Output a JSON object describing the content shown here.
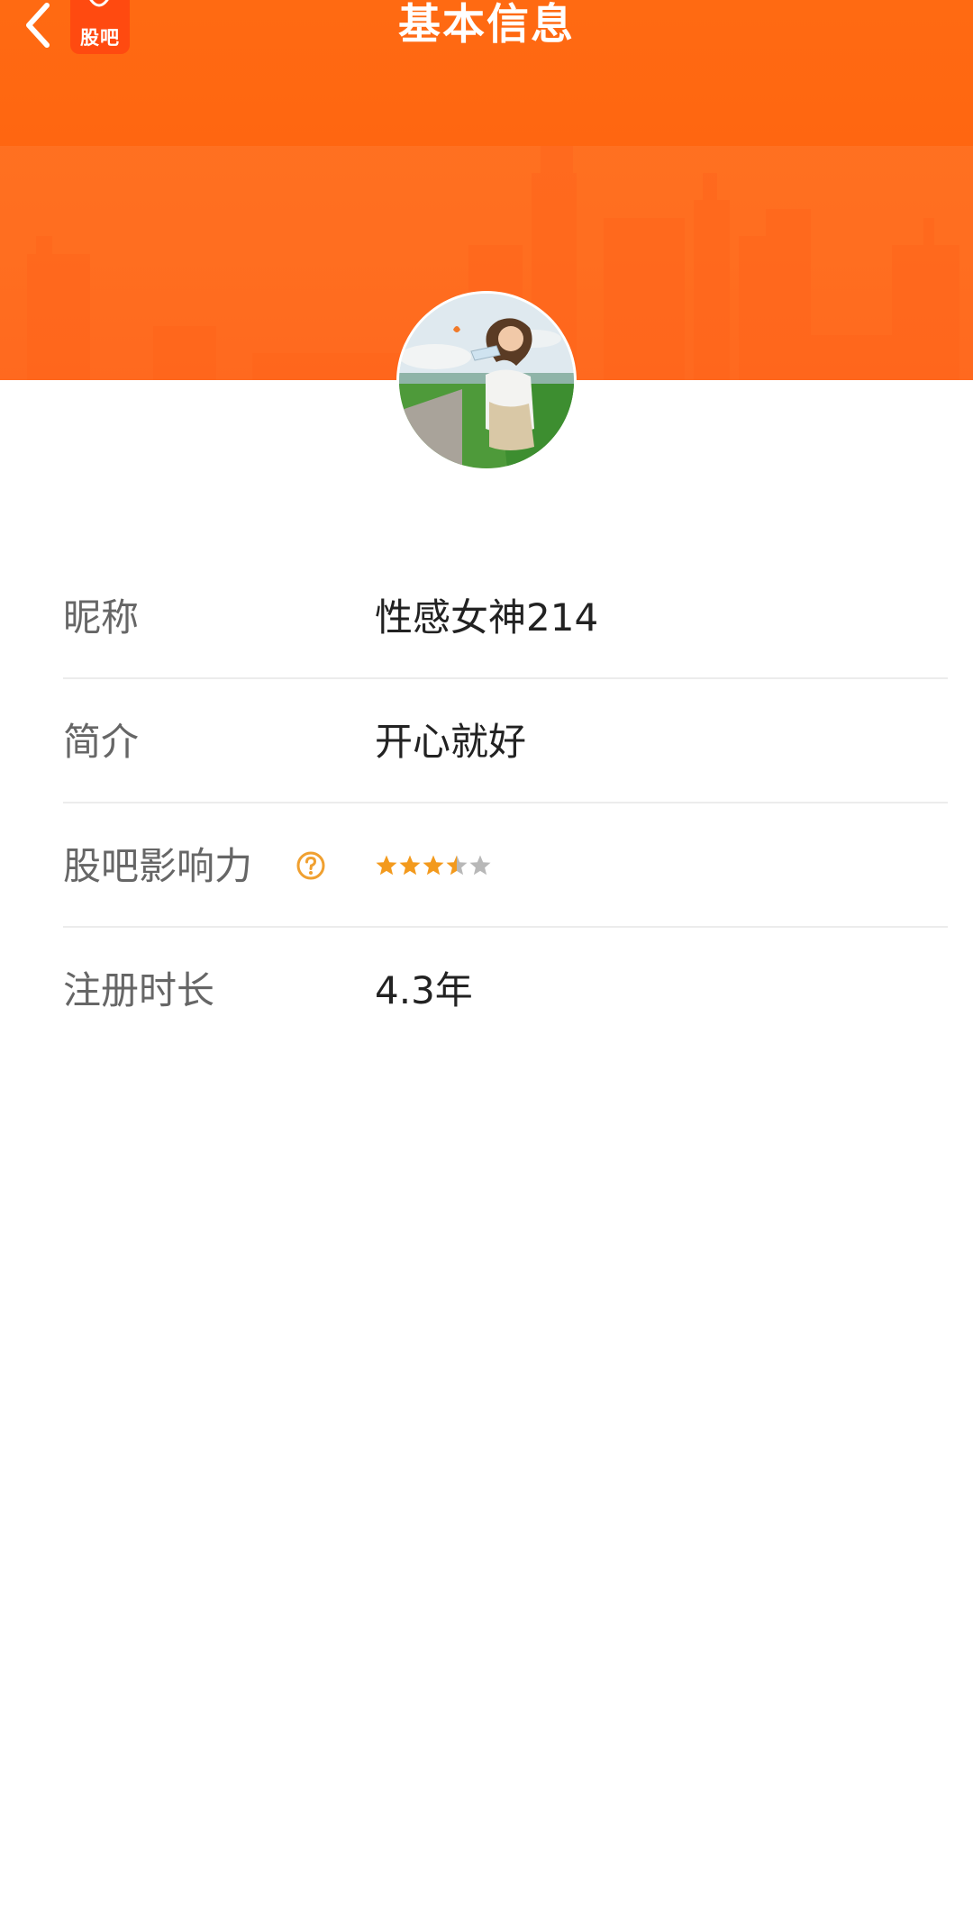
{
  "header": {
    "title": "基本信息",
    "app_logo_text": "股吧",
    "color": "#ff6410"
  },
  "info": {
    "nickname_label": "昵称",
    "nickname_value": "性感女神214",
    "bio_label": "简介",
    "bio_value": "开心就好",
    "influence_label": "股吧影响力",
    "influence_rating": 3.5,
    "influence_rating_max": 5,
    "registration_label": "注册时长",
    "registration_value": "4.3年"
  },
  "icons": {
    "back": "chevron-left-icon",
    "help": "question-circle-icon",
    "star": "star-icon"
  },
  "colors": {
    "star_filled": "#f39a1d",
    "star_empty": "#b8b8b8",
    "help_icon": "#f0a030"
  }
}
